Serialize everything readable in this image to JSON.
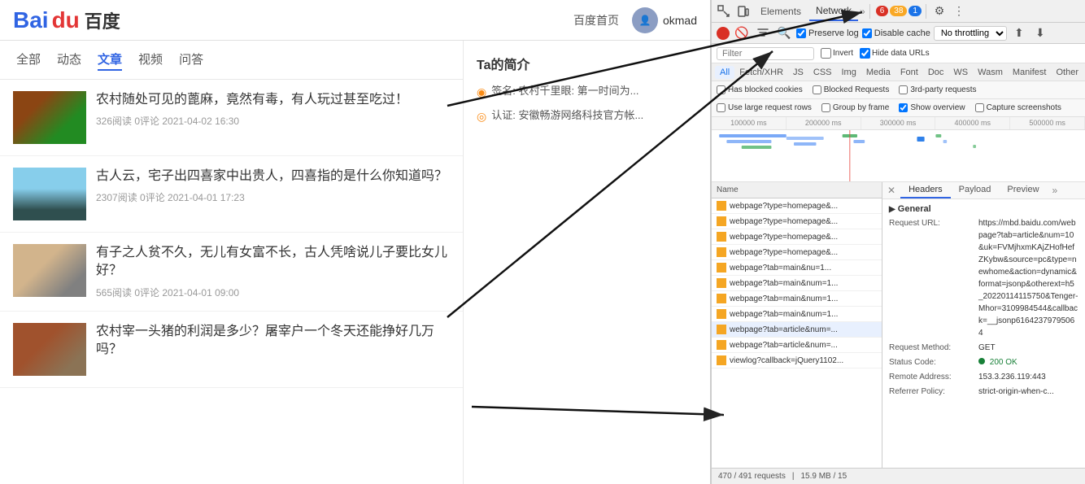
{
  "devtools": {
    "tabs": [
      "Elements",
      "Network"
    ],
    "active_tab": "Network",
    "more_tabs_icon": "»",
    "badges": {
      "error": "6",
      "warning": "38",
      "info": "1"
    },
    "toolbar": {
      "record_title": "Record",
      "clear_title": "Clear",
      "filter_title": "Filter",
      "search_title": "Search",
      "preserve_log_label": "Preserve log",
      "preserve_log_checked": true,
      "disable_cache_label": "Disable cache",
      "disable_cache_checked": true,
      "throttle_value": "No throttling",
      "import_title": "Import",
      "export_title": "Export"
    },
    "filter_bar": {
      "placeholder": "Filter",
      "invert_label": "Invert",
      "hide_data_label": "Hide data URLs",
      "hide_data_checked": true
    },
    "type_tabs": [
      "All",
      "Fetch/XHR",
      "JS",
      "CSS",
      "Img",
      "Media",
      "Font",
      "Doc",
      "WS",
      "Wasm",
      "Manifest",
      "Other"
    ],
    "active_type_tab": "All",
    "more_filters": {
      "has_blocked_label": "Has blocked cookies",
      "blocked_requests_label": "Blocked Requests",
      "third_party_label": "3rd-party requests"
    },
    "display_filters": {
      "use_large_rows_label": "Use large request rows",
      "group_by_frame_label": "Group by frame",
      "show_overview_label": "Show overview",
      "show_overview_checked": true,
      "capture_screenshots_label": "Capture screenshots"
    },
    "timeline": {
      "labels": [
        "100000 ms",
        "200000 ms",
        "300000 ms",
        "400000 ms",
        "500000 ms"
      ]
    },
    "name_list": {
      "header": "Name",
      "items": [
        "webpage?type=homepage&...",
        "webpage?type=homepage&...",
        "webpage?type=homepage&...",
        "webpage?type=homepage&...",
        "webpage?tab=main&nu=1...",
        "webpage?tab=main&num=1...",
        "webpage?tab=main&num=1...",
        "webpage?tab=main&num=1...",
        "webpage?tab=article&num=...",
        "webpage?tab=article&num=...",
        "viewlog?callback=jQuery1102..."
      ],
      "selected_index": 8
    },
    "details": {
      "tabs": [
        "Headers",
        "Payload",
        "Preview"
      ],
      "active_tab": "Headers",
      "general_title": "General",
      "request_url_label": "Request URL:",
      "request_url_value": "https://mbd.baidu.com/webpage?tab=article&num=10&uk=FVMjhxmKAjZHofHefZKybw&source=pc&type=newhome&action=dynamic&format=jsonp&otherext=h5_20220114115750&Tenger-Mhor=3109984544&callback=__jsonp61642379795064",
      "request_method_label": "Request Method:",
      "request_method_value": "GET",
      "status_code_label": "Status Code:",
      "status_code_value": "200 OK",
      "remote_address_label": "Remote Address:",
      "remote_address_value": "153.3.236.119:443",
      "referrer_policy_label": "Referrer Policy:",
      "referrer_policy_value": "strict-origin-when-c..."
    },
    "status_bar": {
      "requests": "470 / 491 requests",
      "transferred": "15.9 MB / 15"
    }
  },
  "webpage": {
    "logo_bai": "Bai",
    "logo_du": "du",
    "logo_text": "百度",
    "home_link": "百度首页",
    "username": "okmad",
    "tabs": [
      "全部",
      "动态",
      "文章",
      "视频",
      "问答"
    ],
    "active_tab": "文章",
    "profile_title": "Ta的简介",
    "profile_items": [
      {
        "icon": "◉",
        "text": "签名: 农村千里眼: 第一时间为..."
      },
      {
        "icon": "◎",
        "text": "认证: 安徽畅游网络科技官方帐..."
      }
    ],
    "articles": [
      {
        "title": "农村随处可见的蓖麻，竟然有毒，有人玩过甚至吃过！",
        "meta": "326阅读 0评论 2021-04-02 16:30",
        "thumb_class": "rambutan"
      },
      {
        "title": "古人云，宅子出四喜家中出贵人，四喜指的是什么你知道吗？",
        "meta": "2307阅读 0评论 2021-04-01 17:23",
        "thumb_class": "water"
      },
      {
        "title": "有子之人贫不久，无儿有女富不长，古人凭啥说儿子要比女儿好？",
        "meta": "565阅读 0评论 2021-04-01 09:00",
        "thumb_class": "person"
      },
      {
        "title": "农村宰一头猪的利润是多少？屠宰户一个冬天还能挣好几万吗？",
        "meta": "",
        "thumb_class": "pig"
      }
    ]
  }
}
